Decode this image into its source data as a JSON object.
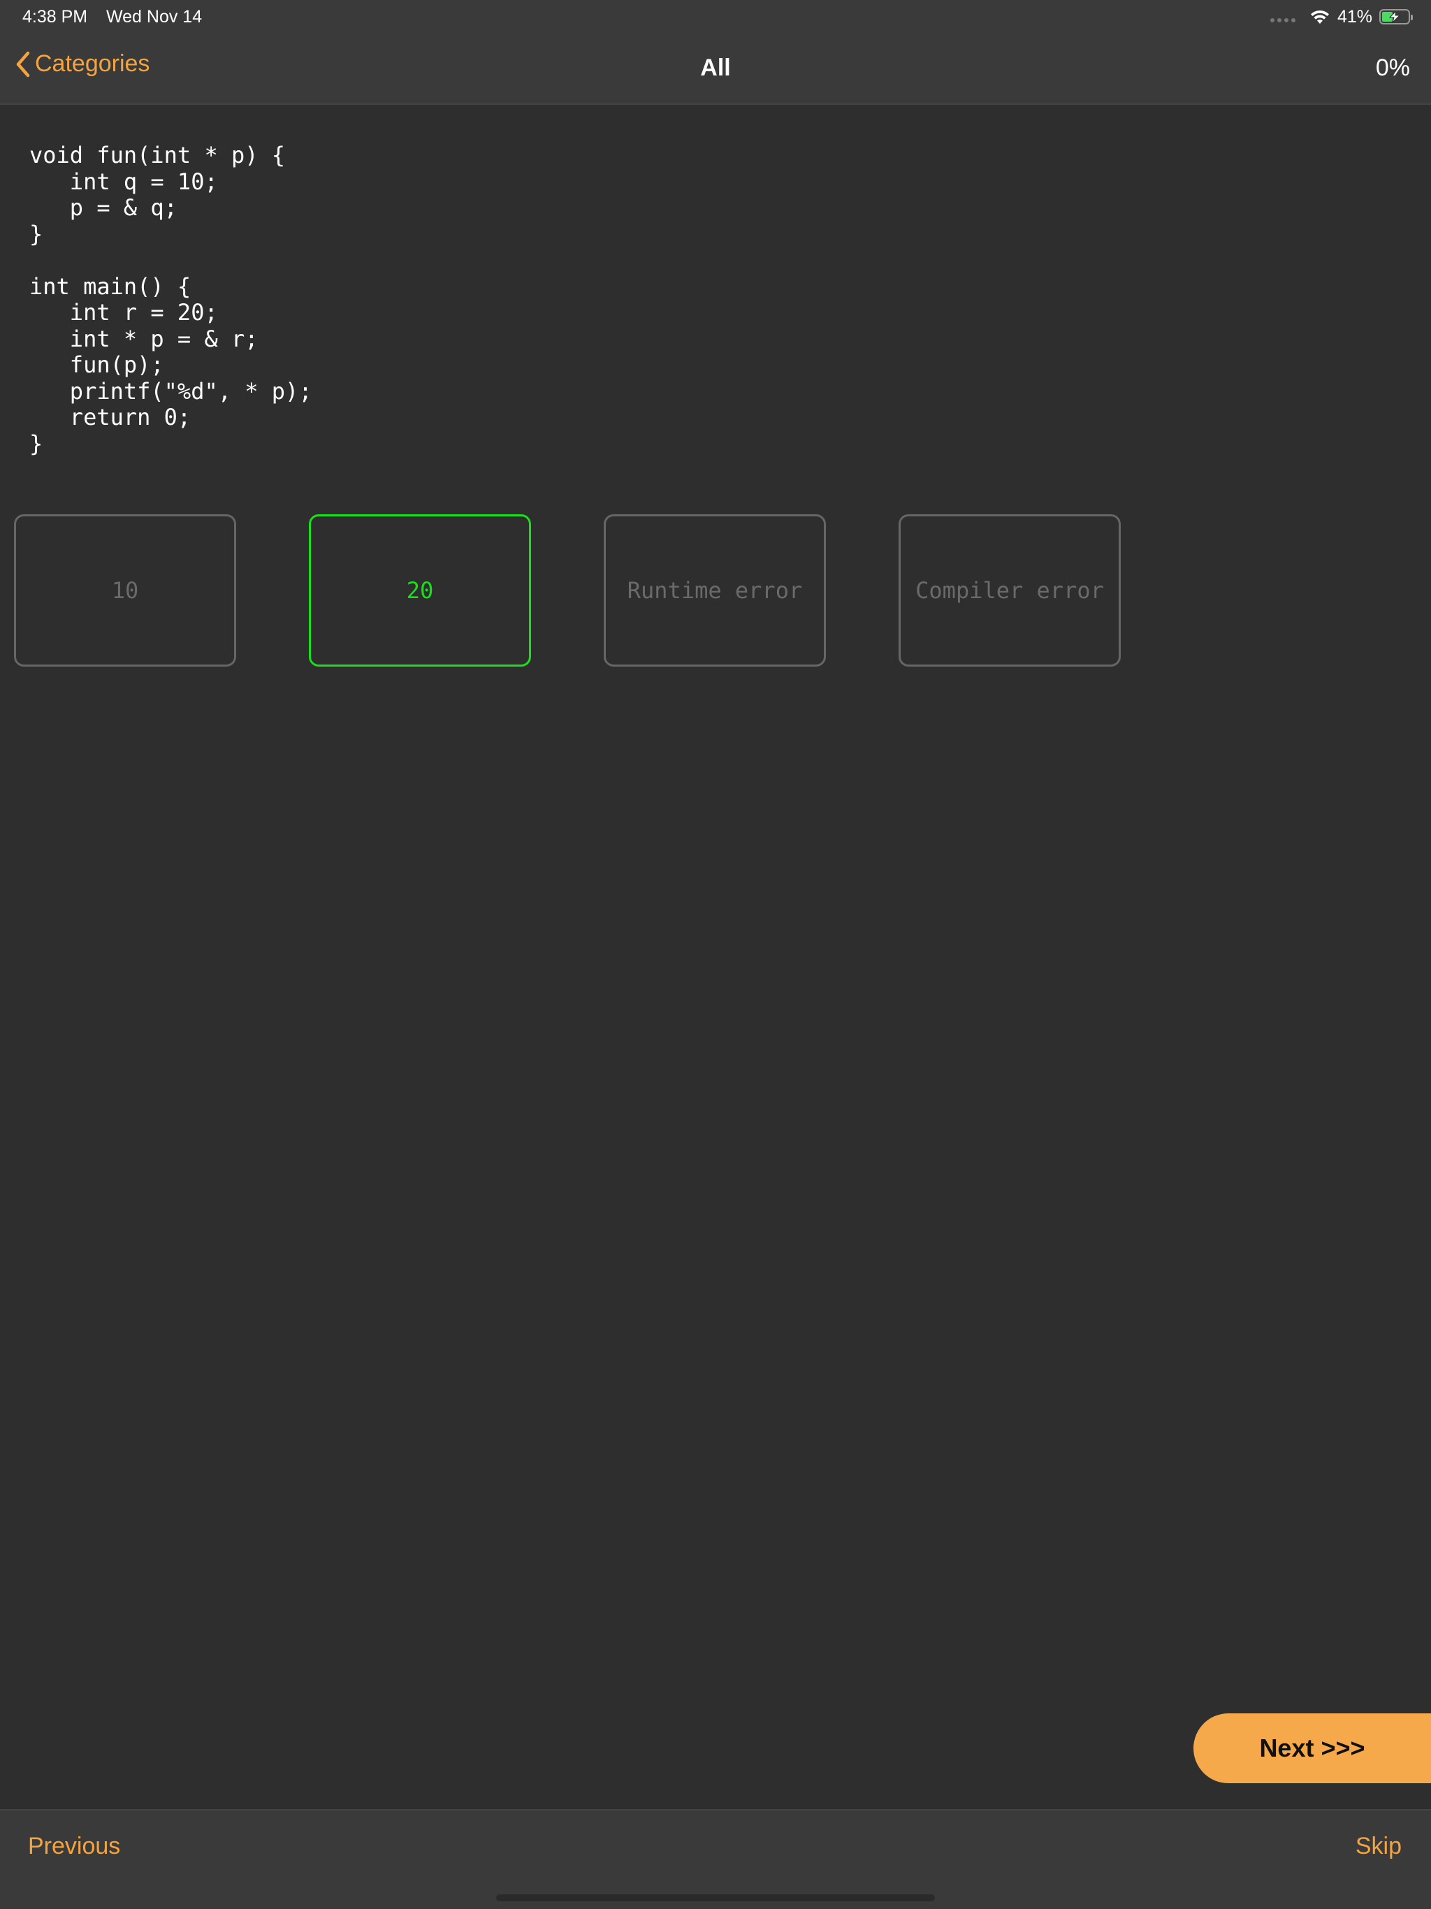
{
  "status_bar": {
    "time": "4:38 PM",
    "date": "Wed Nov 14",
    "battery_percent": "41%",
    "battery_level": 0.41,
    "battery_charging": true,
    "wifi_icon": "wifi-icon",
    "signal_icon": "signal-dots-icon"
  },
  "nav": {
    "back_label": "Categories",
    "back_icon": "chevron-left-icon",
    "title": "All",
    "progress": "0%"
  },
  "question": {
    "code": "void fun(int * p) {\n   int q = 10;\n   p = & q;\n}\n\nint main() {\n   int r = 20;\n   int * p = & r;\n   fun(p);\n   printf(\"%d\", * p);\n   return 0;\n}"
  },
  "answers": [
    {
      "label": "10",
      "selected": false
    },
    {
      "label": "20",
      "selected": true
    },
    {
      "label": "Runtime error",
      "selected": false
    },
    {
      "label": "Compiler error",
      "selected": false
    }
  ],
  "next_button": {
    "label": "Next >>>"
  },
  "bottom_bar": {
    "previous_label": "Previous",
    "skip_label": "Skip"
  },
  "colors": {
    "accent": "#f3a440",
    "next_button_bg": "#f5a94a",
    "correct_green": "#19e119",
    "background": "#2e2e2e",
    "bar_background": "#3a3a3a"
  }
}
